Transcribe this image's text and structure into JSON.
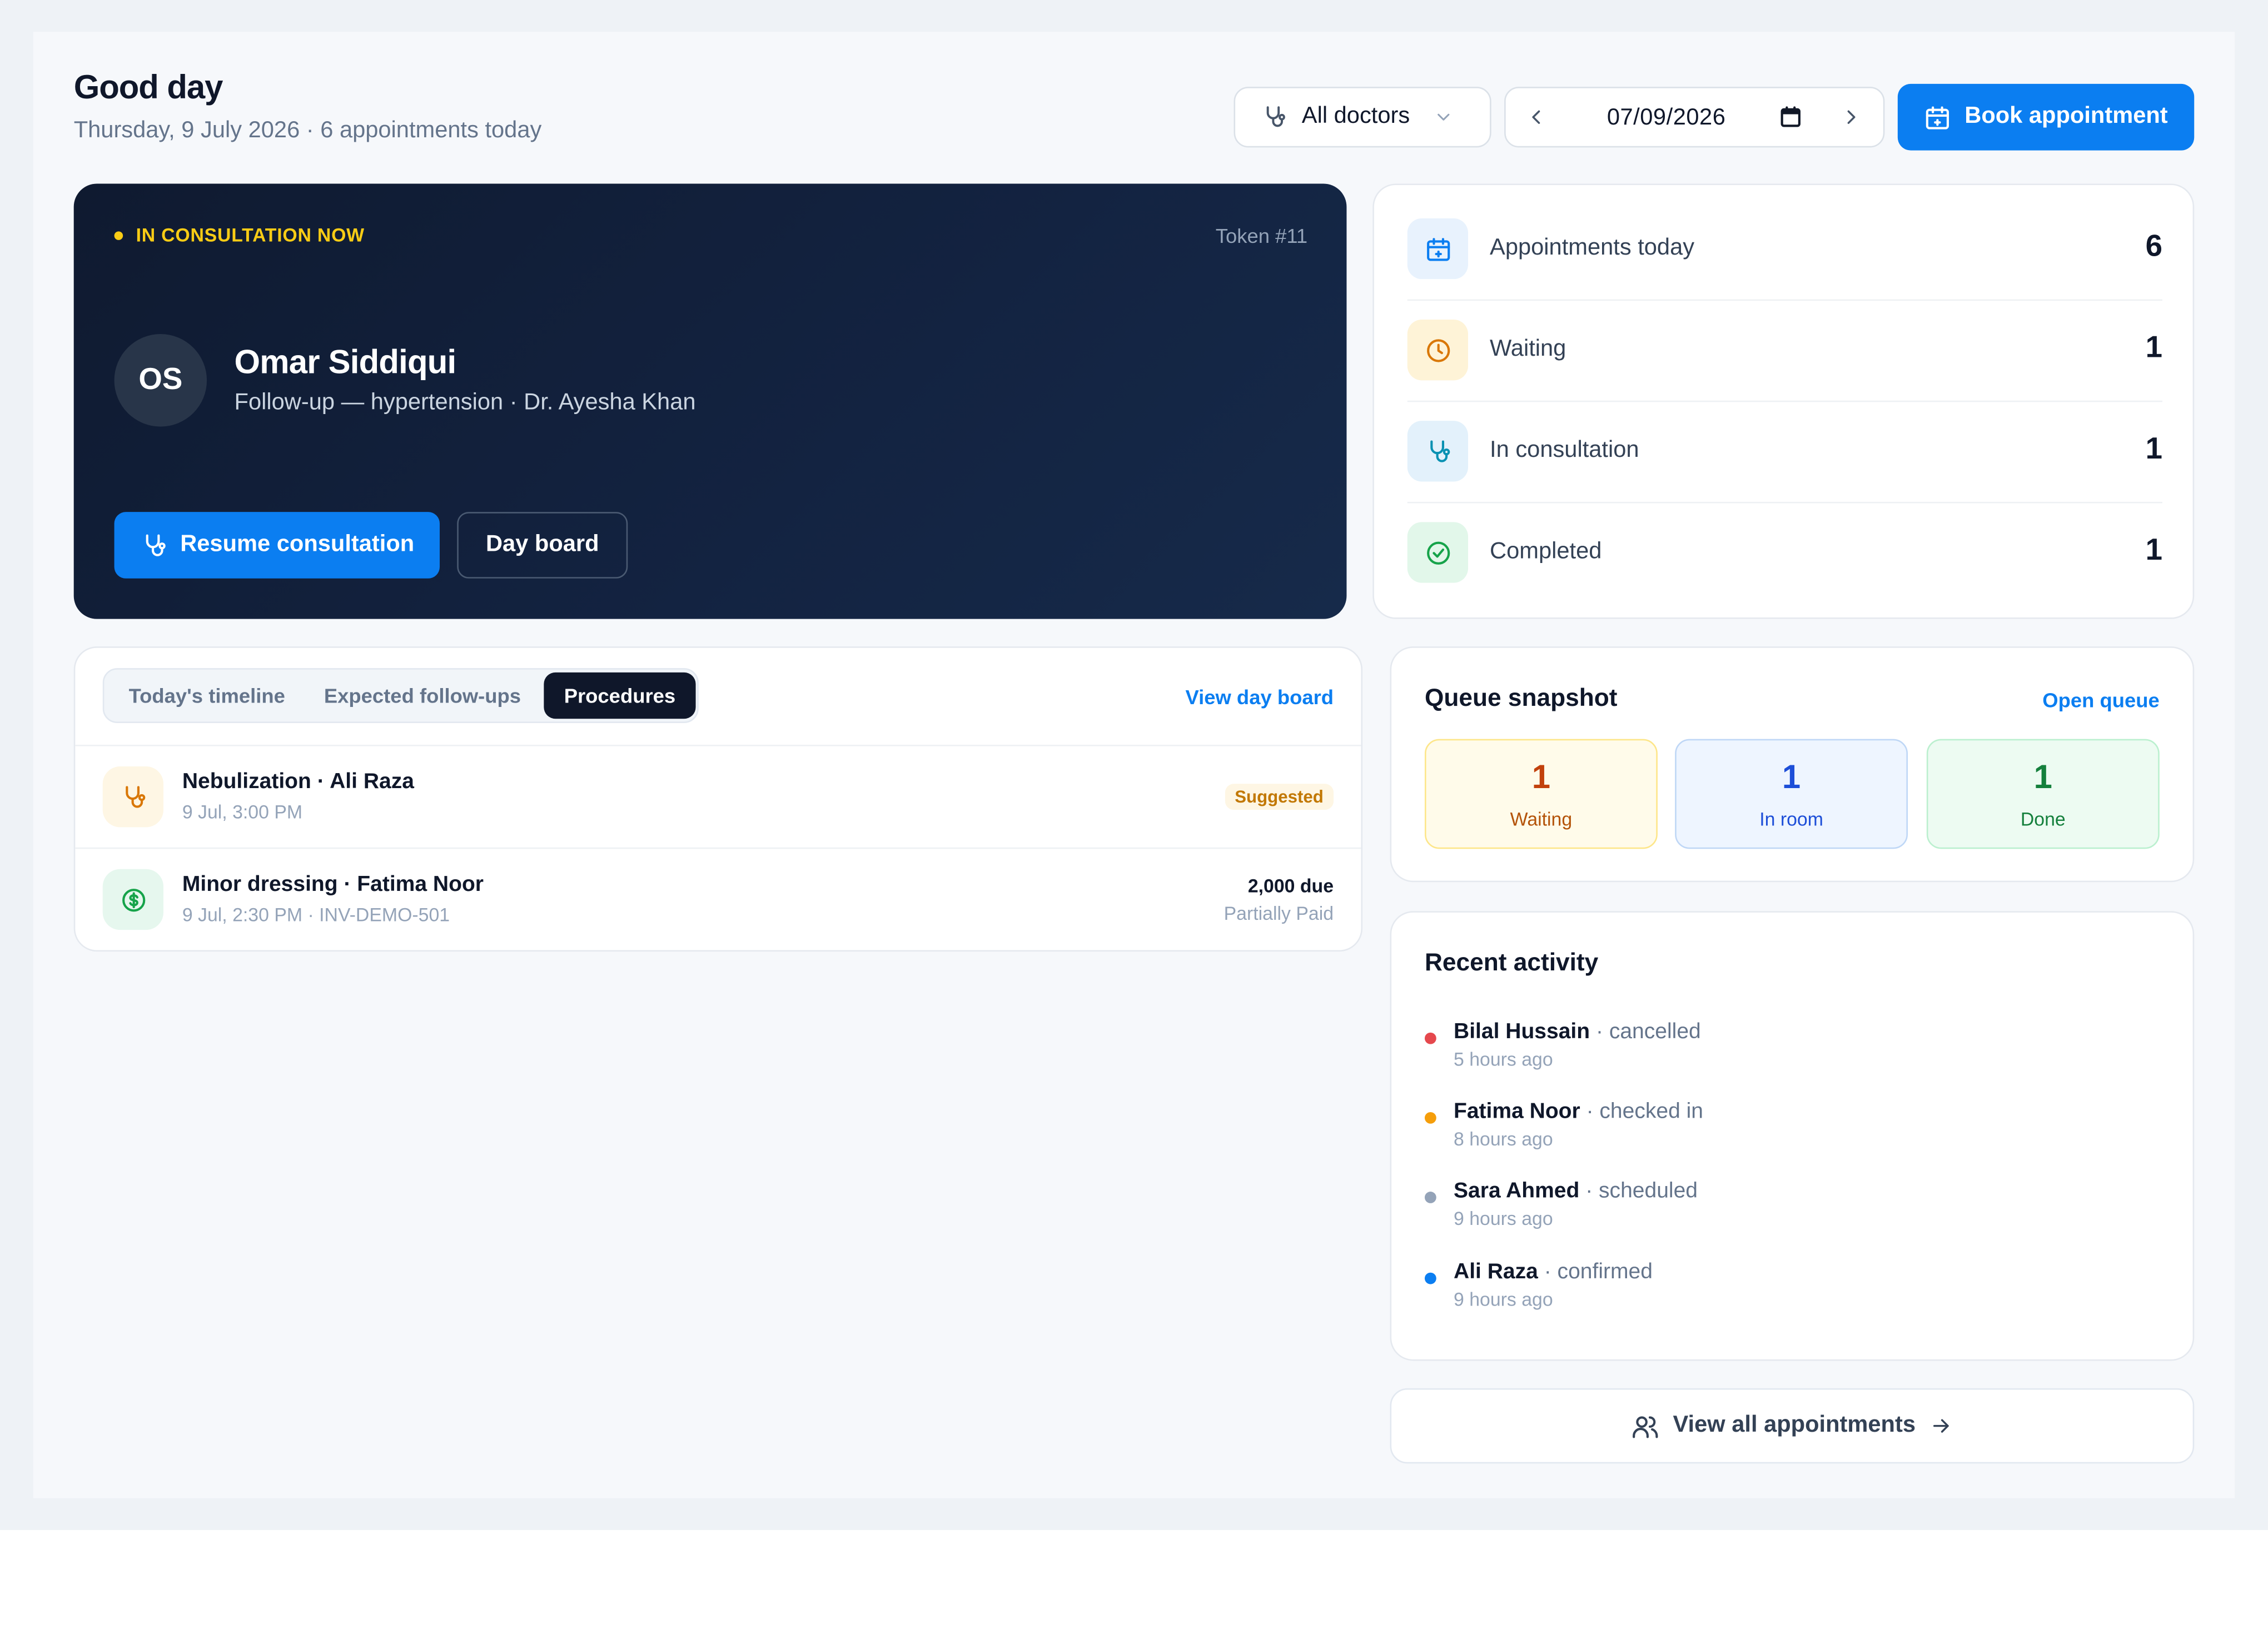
{
  "header": {
    "greeting": "Good day",
    "date_line": "Thursday, 9 July 2026 · 6 appointments today"
  },
  "toolbar": {
    "doctor_filter": "All doctors",
    "date_value": "07/09/2026",
    "book_label": "Book appointment"
  },
  "current": {
    "status": "IN CONSULTATION NOW",
    "token": "Token #11",
    "initials": "OS",
    "patient": "Omar Siddiqui",
    "detail": "Follow-up — hypertension · Dr. Ayesha Khan",
    "resume_label": "Resume consultation",
    "dayboard_label": "Day board"
  },
  "stats": [
    {
      "label": "Appointments today",
      "value": "6",
      "icon": "calendar-plus-icon",
      "color": "#0b7ef1",
      "bg": "#e8f2fd"
    },
    {
      "label": "Waiting",
      "value": "1",
      "icon": "clock-icon",
      "color": "#d97706",
      "bg": "#fef3d7"
    },
    {
      "label": "In consultation",
      "value": "1",
      "icon": "stethoscope-icon",
      "color": "#0891b2",
      "bg": "#e3f1fb"
    },
    {
      "label": "Completed",
      "value": "1",
      "icon": "check-circle-icon",
      "color": "#16a34a",
      "bg": "#e2f7ea"
    }
  ],
  "tabs": {
    "items": [
      "Today's timeline",
      "Expected follow-ups",
      "Procedures"
    ],
    "active": "Procedures",
    "view_board": "View day board"
  },
  "procedures": [
    {
      "title": "Nebulization · Ali Raza",
      "sub": "9 Jul, 3:00 PM",
      "badge": "Suggested",
      "icon": "stethoscope-icon"
    },
    {
      "title": "Minor dressing · Fatima Noor",
      "sub": "9 Jul, 2:30 PM · INV-DEMO-501",
      "amount": "2,000 due",
      "status": "Partially Paid",
      "icon": "dollar-circle-icon"
    }
  ],
  "queue": {
    "title": "Queue snapshot",
    "link": "Open queue",
    "boxes": [
      {
        "value": "1",
        "label": "Waiting"
      },
      {
        "value": "1",
        "label": "In room"
      },
      {
        "value": "1",
        "label": "Done"
      }
    ]
  },
  "activity": {
    "title": "Recent activity",
    "items": [
      {
        "name": "Bilal Hussain",
        "action": "· cancelled",
        "time": "5 hours ago",
        "color": "#e5484d"
      },
      {
        "name": "Fatima Noor",
        "action": "· checked in",
        "time": "8 hours ago",
        "color": "#f59e0b"
      },
      {
        "name": "Sara Ahmed",
        "action": "· scheduled",
        "time": "9 hours ago",
        "color": "#94a3b8"
      },
      {
        "name": "Ali Raza",
        "action": "· confirmed",
        "time": "9 hours ago",
        "color": "#0b7ef1"
      }
    ]
  },
  "footer": {
    "view_all": "View all appointments"
  }
}
